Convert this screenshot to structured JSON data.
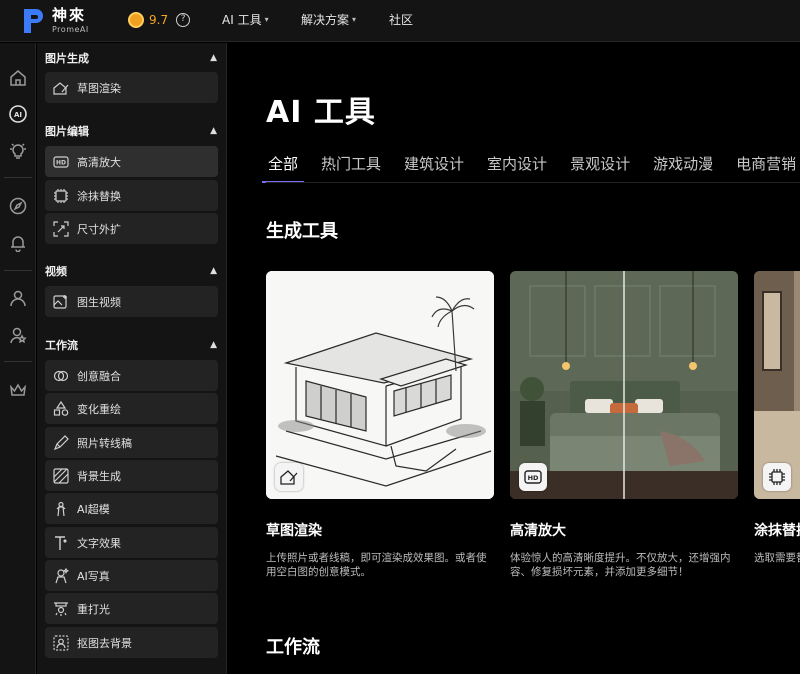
{
  "brand": {
    "name_cn": "神來",
    "name_en": "PromeAI"
  },
  "topbar": {
    "score": "9.7",
    "help_glyph": "?",
    "nav": [
      {
        "label": "AI 工具",
        "dropdown": true
      },
      {
        "label": "解决方案",
        "dropdown": true
      },
      {
        "label": "社区",
        "dropdown": false
      }
    ]
  },
  "rail": {
    "icons": [
      "home-icon",
      "ai-icon",
      "bulb-icon",
      "compass-icon",
      "bell-icon",
      "user-icon",
      "user-star-icon",
      "crown-icon"
    ]
  },
  "sidebar": {
    "sections": [
      {
        "title": "图片生成",
        "items": [
          {
            "label": "草图渲染",
            "icon": "sketch-render-icon"
          }
        ]
      },
      {
        "title": "图片编辑",
        "items": [
          {
            "label": "高清放大",
            "icon": "hd-icon",
            "active": true
          },
          {
            "label": "涂抹替换",
            "icon": "brush-replace-icon"
          },
          {
            "label": "尺寸外扩",
            "icon": "expand-icon"
          }
        ]
      },
      {
        "title": "视频",
        "items": [
          {
            "label": "图生视频",
            "icon": "image-video-icon"
          }
        ]
      },
      {
        "title": "工作流",
        "items": [
          {
            "label": "创意融合",
            "icon": "fusion-icon"
          },
          {
            "label": "变化重绘",
            "icon": "shapes-icon"
          },
          {
            "label": "照片转线稿",
            "icon": "pen-icon"
          },
          {
            "label": "背景生成",
            "icon": "background-icon"
          },
          {
            "label": "AI超模",
            "icon": "model-icon"
          },
          {
            "label": "文字效果",
            "icon": "text-effect-icon"
          },
          {
            "label": "AI写真",
            "icon": "portrait-icon"
          },
          {
            "label": "重打光",
            "icon": "relight-icon"
          },
          {
            "label": "抠图去背景",
            "icon": "remove-bg-icon"
          }
        ]
      }
    ]
  },
  "main": {
    "title": "AI 工具",
    "tabs": [
      {
        "label": "全部",
        "active": true
      },
      {
        "label": "热门工具"
      },
      {
        "label": "建筑设计"
      },
      {
        "label": "室内设计"
      },
      {
        "label": "景观设计"
      },
      {
        "label": "游戏动漫"
      },
      {
        "label": "电商营销"
      }
    ],
    "section_generate": "生成工具",
    "section_workflow": "工作流",
    "cards": [
      {
        "title": "草图渲染",
        "desc": "上传照片或者线稿，即可渲染成效果图。或者使用空白图的创意模式。",
        "badge_icon": "sketch-render-icon"
      },
      {
        "title": "高清放大",
        "desc": "体验惊人的高清晰度提升。不仅放大，还增强内容、修复损坏元素，并添加更多细节！",
        "badge_icon": "hd-icon"
      },
      {
        "title": "涂抹替换",
        "desc": "选取需要替换的区域，输入描述即可。",
        "badge_icon": "brush-replace-icon"
      }
    ]
  },
  "colors": {
    "accent": "#7a6cf0",
    "coin": "#f5a623",
    "brand_blue": "#3b7bf7"
  }
}
